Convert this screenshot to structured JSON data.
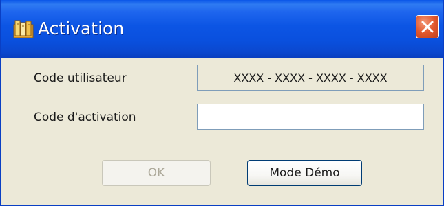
{
  "window": {
    "title": "Activation",
    "close_label": "×"
  },
  "form": {
    "user_code_label": "Code utilisateur",
    "user_code_value": "XXXX - XXXX - XXXX - XXXX",
    "activation_code_label": "Code d'activation",
    "activation_code_value": ""
  },
  "buttons": {
    "ok_label": "OK",
    "ok_enabled": false,
    "demo_label": "Mode Démo"
  },
  "colors": {
    "titlebar": "#0a56e8",
    "close_button": "#e1572c",
    "dialog_background": "#ece9d8"
  },
  "icons": {
    "title_icon": "app-icon",
    "close_icon": "close-icon"
  }
}
